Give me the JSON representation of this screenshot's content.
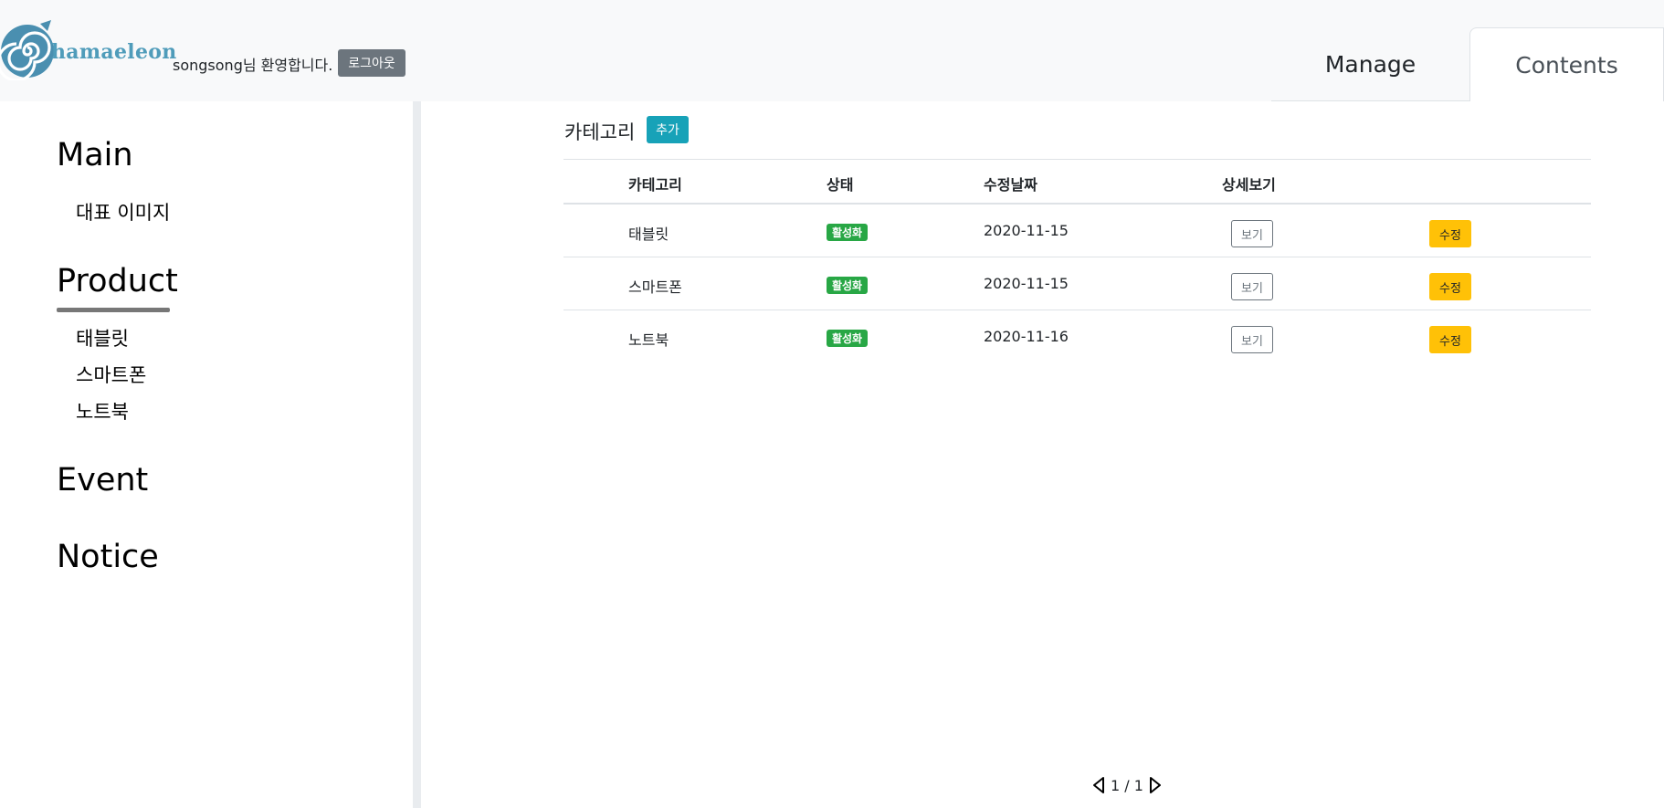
{
  "header": {
    "logo_text": "hamaeleon",
    "welcome": "songsong님 환영합니다.",
    "logout_label": "로그아웃",
    "tabs": [
      {
        "label": "Manage",
        "active": false
      },
      {
        "label": "Contents",
        "active": true
      }
    ]
  },
  "sidebar": {
    "sections": [
      {
        "label": "Main",
        "items": [
          "대표 이미지"
        ]
      },
      {
        "label": "Product",
        "items": [
          "태블릿",
          "스마트폰",
          "노트북"
        ],
        "active": true
      },
      {
        "label": "Event",
        "items": []
      },
      {
        "label": "Notice",
        "items": []
      }
    ]
  },
  "main": {
    "title": "카테고리",
    "add_label": "추가",
    "table": {
      "headers": [
        "카테고리",
        "상태",
        "수정날짜",
        "상세보기",
        ""
      ],
      "rows": [
        {
          "category": "태블릿",
          "status": "활성화",
          "date": "2020-11-15",
          "view": "보기",
          "edit": "수정"
        },
        {
          "category": "스마트폰",
          "status": "활성화",
          "date": "2020-11-15",
          "view": "보기",
          "edit": "수정"
        },
        {
          "category": "노트북",
          "status": "활성화",
          "date": "2020-11-16",
          "view": "보기",
          "edit": "수정"
        }
      ]
    },
    "pagination": {
      "text": "1 / 1"
    }
  },
  "colors": {
    "header_bg": "#f8f9fa",
    "logout_bg": "#6c757d",
    "add_bg": "#17a2b8",
    "badge_bg": "#28a745",
    "edit_bg": "#ffc107"
  }
}
